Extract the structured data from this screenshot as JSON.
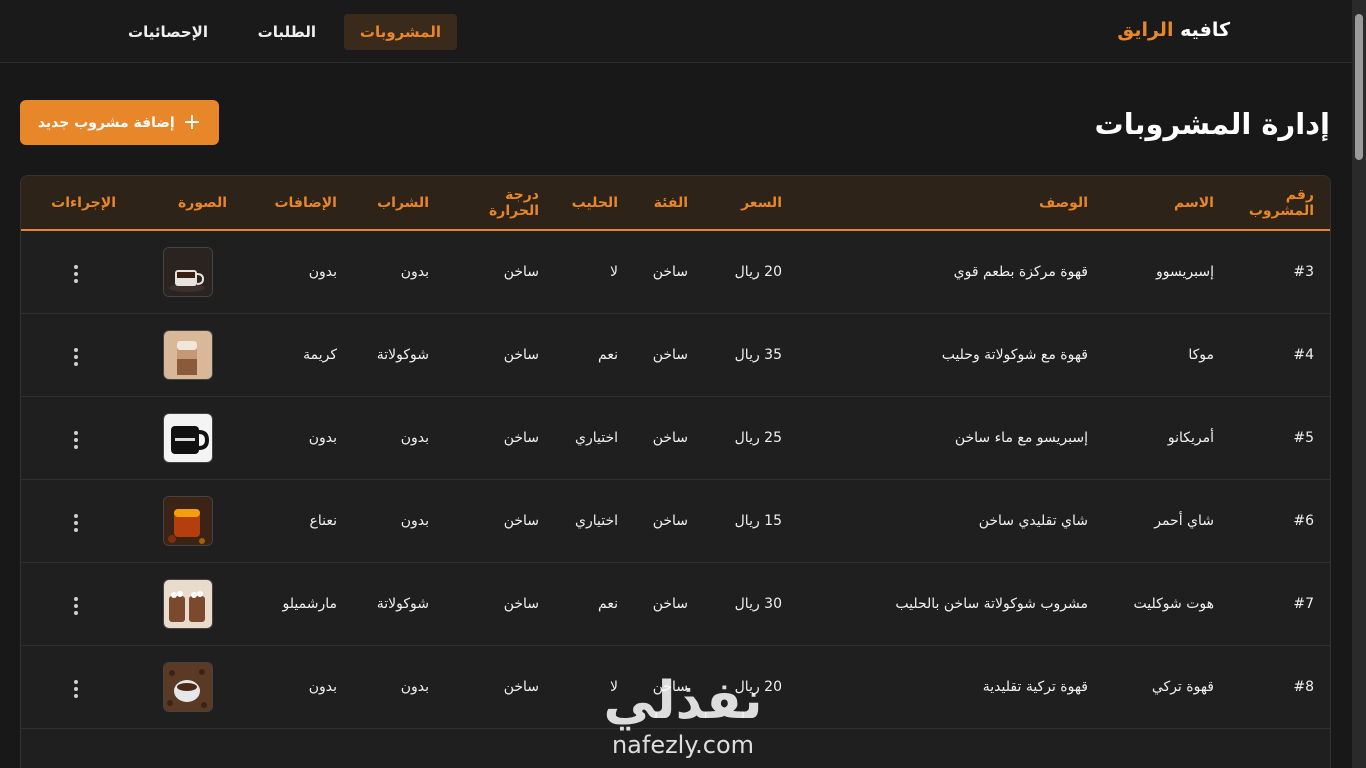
{
  "brand": {
    "name": "كافيه",
    "accent": "الرايق"
  },
  "nav": [
    {
      "label": "المشروبات",
      "active": true
    },
    {
      "label": "الطلبات",
      "active": false
    },
    {
      "label": "الإحصائيات",
      "active": false
    }
  ],
  "page_title": "إدارة المشروبات",
  "add_button": {
    "plus": "+",
    "label": "إضافة مشروب جديد"
  },
  "columns": [
    "رقم المشروب",
    "الاسم",
    "الوصف",
    "السعر",
    "الفئة",
    "الحليب",
    "درجة الحرارة",
    "الشراب",
    "الإضافات",
    "الصورة",
    "الإجراءات"
  ],
  "rows": [
    {
      "id": "#3",
      "name": "إسبريسوو",
      "desc": "قهوة مركزة بطعم قوي",
      "price": "20 ريال",
      "category": "ساخن",
      "milk": "لا",
      "temp": "ساخن",
      "syrup": "بدون",
      "extras": "بدون",
      "image_icon": "espresso-image"
    },
    {
      "id": "#4",
      "name": "موكا",
      "desc": "قهوة مع شوكولاتة وحليب",
      "price": "35 ريال",
      "category": "ساخن",
      "milk": "نعم",
      "temp": "ساخن",
      "syrup": "شوكولاتة",
      "extras": "كريمة",
      "image_icon": "mocha-image"
    },
    {
      "id": "#5",
      "name": "أمريكانو",
      "desc": "إسبريسو مع ماء ساخن",
      "price": "25 ريال",
      "category": "ساخن",
      "milk": "اختياري",
      "temp": "ساخن",
      "syrup": "بدون",
      "extras": "بدون",
      "image_icon": "americano-image"
    },
    {
      "id": "#6",
      "name": "شاي أحمر",
      "desc": "شاي تقليدي ساخن",
      "price": "15 ريال",
      "category": "ساخن",
      "milk": "اختياري",
      "temp": "ساخن",
      "syrup": "بدون",
      "extras": "نعناع",
      "image_icon": "tea-image"
    },
    {
      "id": "#7",
      "name": "هوت شوكليت",
      "desc": "مشروب شوكولاتة ساخن بالحليب",
      "price": "30 ريال",
      "category": "ساخن",
      "milk": "نعم",
      "temp": "ساخن",
      "syrup": "شوكولاتة",
      "extras": "مارشميلو",
      "image_icon": "hot-chocolate-image"
    },
    {
      "id": "#8",
      "name": "قهوة تركي",
      "desc": "قهوة تركية تقليدية",
      "price": "20 ريال",
      "category": "ساخن",
      "milk": "لا",
      "temp": "ساخن",
      "syrup": "بدون",
      "extras": "بدون",
      "image_icon": "turkish-coffee-image"
    }
  ],
  "watermark": {
    "arabic": "نفذلي",
    "latin": "nafezly.com"
  },
  "colors": {
    "accent": "#e8862a",
    "background": "#181818",
    "header_row": "#2d2319"
  }
}
